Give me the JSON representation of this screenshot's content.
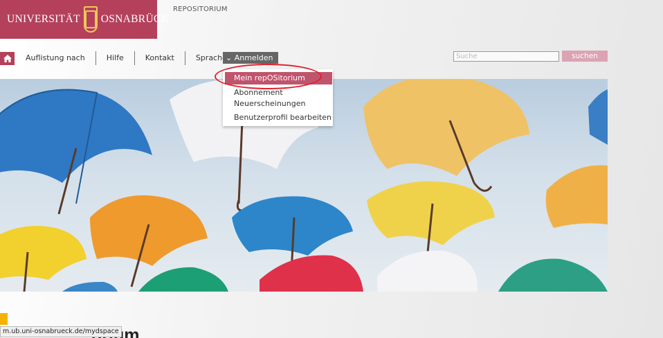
{
  "header": {
    "logo_left": "UNIVERSITÄT",
    "logo_right": "OSNABRÜCK",
    "repo_title": "REPOSITORIUM"
  },
  "nav": {
    "home_icon": "home-icon",
    "items": [
      "Auflistung nach",
      "Hilfe",
      "Kontakt",
      "Sprache"
    ],
    "login_label": "Anmelden"
  },
  "search": {
    "placeholder": "Suche",
    "button_label": "suchen"
  },
  "dropdown": {
    "items": [
      "Mein repOSitorium",
      "Abonnement",
      "Neuerscheinungen",
      "Benutzerprofil bearbeiten"
    ],
    "active_index": 0
  },
  "page": {
    "heading_fragment": "orium"
  },
  "status_bar": {
    "url": "m.ub.uni-osnabrueck.de/mydspace"
  },
  "colors": {
    "brand": "#b5405c",
    "active_menu": "#c0546d",
    "search_button": "#dca3b3",
    "highlight_ring": "#e0202a",
    "accent": "#f5b300"
  }
}
